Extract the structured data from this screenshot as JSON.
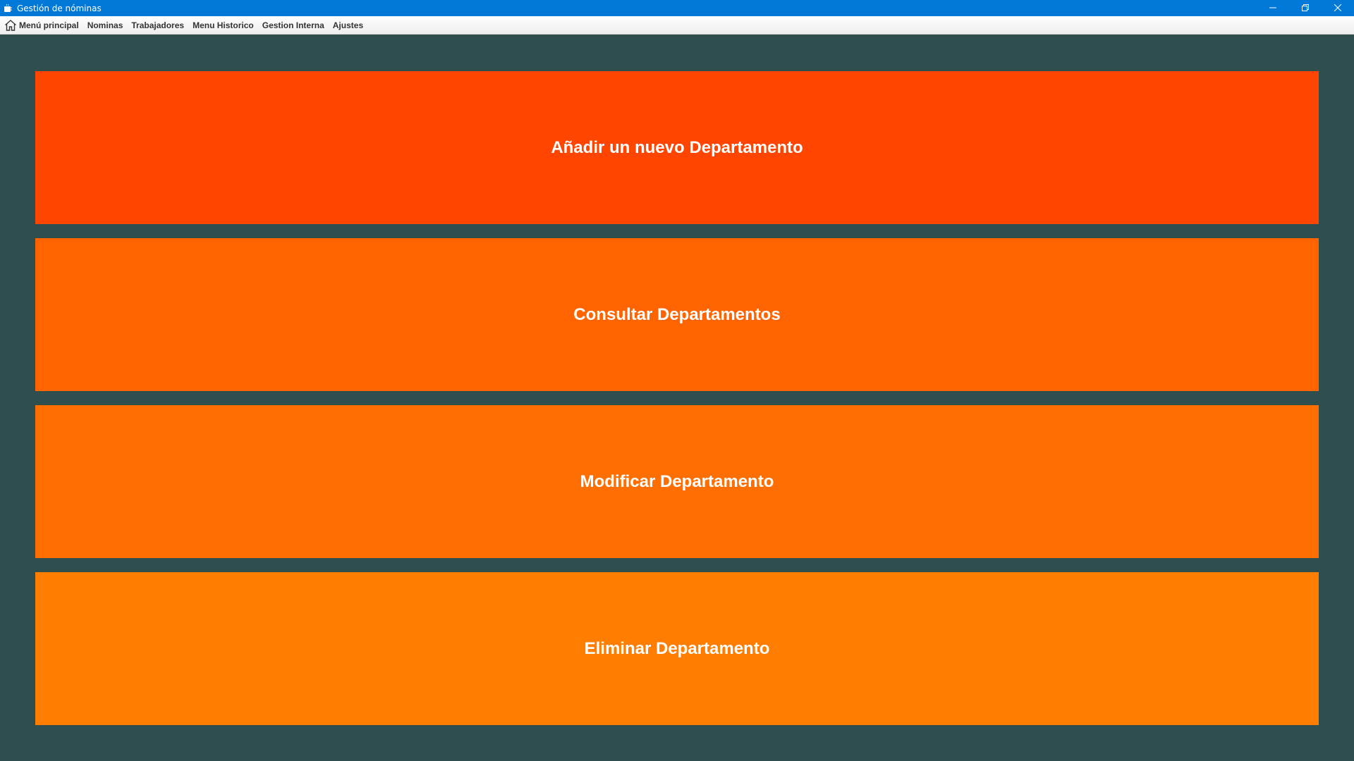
{
  "window": {
    "title": "Gestión de nóminas"
  },
  "menu": {
    "items": [
      {
        "label": "Menú principal",
        "icon": "home-icon"
      },
      {
        "label": "Nominas"
      },
      {
        "label": "Trabajadores"
      },
      {
        "label": "Menu Historico"
      },
      {
        "label": "Gestion Interna"
      },
      {
        "label": "Ajustes"
      }
    ]
  },
  "main": {
    "buttons": [
      {
        "label": "Añadir un nuevo Departamento",
        "color": "#ff4500"
      },
      {
        "label": "Consultar Departamentos",
        "color": "#ff6400"
      },
      {
        "label": "Modificar Departamento",
        "color": "#ff6e00"
      },
      {
        "label": "Eliminar Departamento",
        "color": "#ff7d00"
      }
    ]
  },
  "colors": {
    "titlebar": "#0078d7",
    "background": "#2f4f4f"
  }
}
